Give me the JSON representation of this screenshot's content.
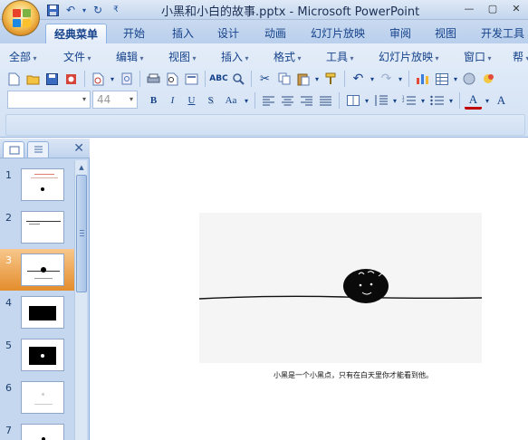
{
  "window": {
    "title": "小黑和小白的故事.pptx - Microsoft PowerPoint",
    "controls": [
      "—",
      "▢",
      "✕"
    ]
  },
  "ribbon_tabs": [
    {
      "label": "经典菜单",
      "active": true
    },
    {
      "label": "开始"
    },
    {
      "label": "插入"
    },
    {
      "label": "设计"
    },
    {
      "label": "动画"
    },
    {
      "label": "幻灯片放映"
    },
    {
      "label": "审阅"
    },
    {
      "label": "视图"
    },
    {
      "label": "开发工具"
    }
  ],
  "classic_menu": [
    "全部",
    "文件",
    "编辑",
    "视图",
    "插入",
    "格式",
    "工具",
    "幻灯片放映",
    "窗口",
    "帮"
  ],
  "font": {
    "name_value": "",
    "size_value": "44"
  },
  "slides_panel": {
    "thumbnails": [
      {
        "number": "1"
      },
      {
        "number": "2"
      },
      {
        "number": "3",
        "selected": true
      },
      {
        "number": "4"
      },
      {
        "number": "5"
      },
      {
        "number": "6"
      },
      {
        "number": "7"
      }
    ]
  },
  "slide": {
    "caption": "小黑是一个小黑点，只有在白天里你才能看到他。"
  },
  "colors": {
    "ribbon_bg": "#d2e1f4",
    "selected_thumb": "#e48d2c",
    "panel_bg": "#c5d7ee"
  }
}
